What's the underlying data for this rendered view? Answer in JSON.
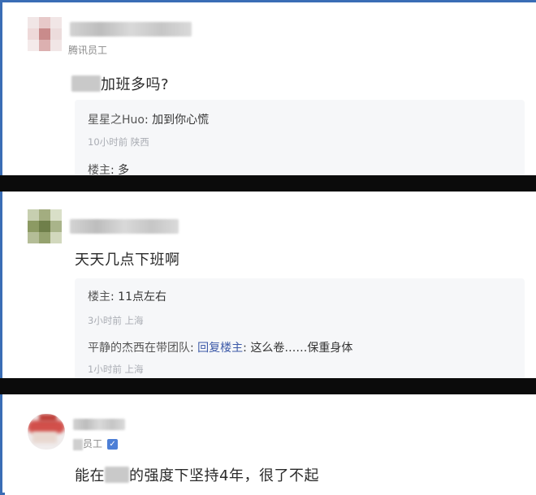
{
  "posts": [
    {
      "subtitle": "腾讯员工",
      "comment_prefix": "",
      "comment_suffix": "加班多吗?",
      "replies": [
        {
          "author": "星星之Huo",
          "sep": ":",
          "text": "加到你心慌",
          "meta": "10小时前 陕西"
        },
        {
          "author": "楼主",
          "sep": ":",
          "text": "多",
          "meta": ""
        }
      ]
    },
    {
      "comment": "天天几点下班啊",
      "replies": [
        {
          "author": "楼主",
          "sep": ":",
          "text": "11点左右",
          "meta": "3小时前 上海"
        },
        {
          "author": "平静的杰西在带团队",
          "sep": ":",
          "link": "回复楼主",
          "link_sep": ":",
          "text": "这么卷……保重身体",
          "meta": "1小时前 上海"
        }
      ]
    },
    {
      "subtitle": "员工",
      "comment_prefix": "能在",
      "comment_suffix": "的强度下坚持4年，很了不起"
    }
  ],
  "colors": {
    "frame": "#3a6db5",
    "divider": "#0b0b0b",
    "link": "#3d5aa8",
    "reply_bg": "#f6f7f9"
  }
}
